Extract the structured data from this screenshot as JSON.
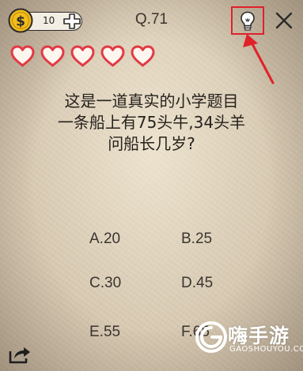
{
  "coins": {
    "count": "10"
  },
  "header": {
    "question_number": "Q.71"
  },
  "lives": {
    "count": 5,
    "color": "#e23a45"
  },
  "question": {
    "lines": [
      "这是一道真实的小学题目",
      "一条船上有75头牛,34头羊",
      "问船长几岁?"
    ]
  },
  "options": [
    "A.20",
    "B.25",
    "C.30",
    "D.45",
    "E.55",
    "F.65"
  ],
  "hint": {
    "highlight_color": "#e1212a"
  },
  "watermark": {
    "brand": "嗨手游",
    "domain": "GAOSHOUYOU.COM"
  }
}
